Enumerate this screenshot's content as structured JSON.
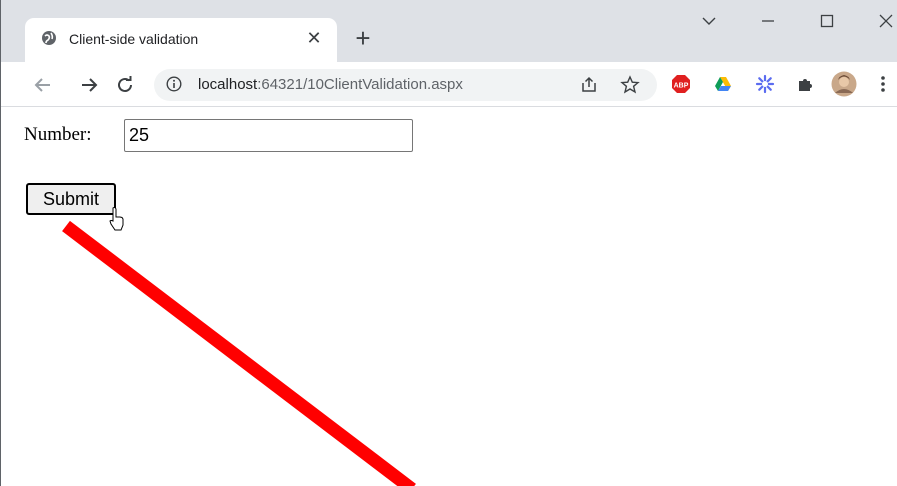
{
  "browser": {
    "tab": {
      "title": "Client-side validation"
    },
    "address_bar": {
      "host": "localhost",
      "path": ":64321/10ClientValidation.aspx"
    },
    "colors": {
      "tabstrip": "#dee1e6",
      "annotation_line": "#ff0000"
    }
  },
  "page": {
    "number_label": "Number:",
    "number_value": "25",
    "submit_label": "Submit"
  }
}
